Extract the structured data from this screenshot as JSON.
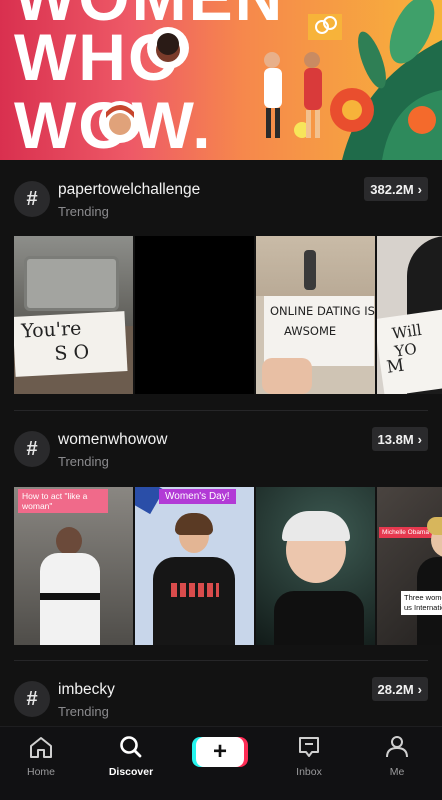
{
  "banner": {
    "line1": "WOMEN",
    "line2": "WHO",
    "line3": "WOW."
  },
  "hashtags": [
    {
      "name": "papertowelchallenge",
      "subtitle": "Trending",
      "count": "382.2M"
    },
    {
      "name": "womenwhowow",
      "subtitle": "Trending",
      "count": "13.8M"
    },
    {
      "name": "imbecky",
      "subtitle": "Trending",
      "count": "28.2M"
    }
  ],
  "thumb_text": {
    "paper1_l1": "You're",
    "paper1_l2": "S O",
    "paper2_l1": "ONLINE DATING IS",
    "paper2_l2": "AWSOME",
    "paper3_l1": "Will YO",
    "paper3_l2": "M",
    "ww1_caption": "How to act \"like a woman\"",
    "ww2_caption": "Women's Day!",
    "ww4_tag": "Michelle Obama",
    "ww4_caption": "Three wome inspire us International Wo"
  },
  "nav": {
    "home": "Home",
    "discover": "Discover",
    "inbox": "Inbox",
    "me": "Me",
    "active": "Discover"
  },
  "colors": {
    "background": "#121212",
    "accent_cyan": "#25f4ee",
    "accent_red": "#fe2c55"
  }
}
